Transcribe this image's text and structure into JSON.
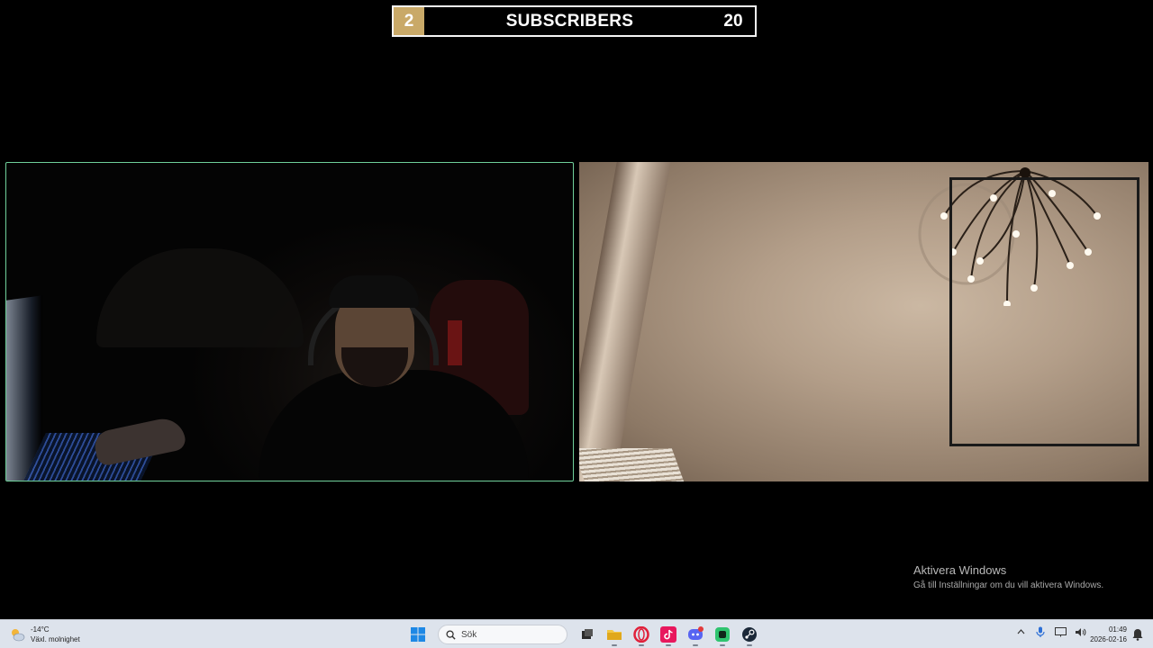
{
  "subscriber_bar": {
    "current": "2",
    "label": "SUBSCRIBERS",
    "goal": "20",
    "accent": "#c9a968"
  },
  "watermark": {
    "title": "Aktivera Windows",
    "subtitle": "Gå till Inställningar om du vill aktivera Windows."
  },
  "taskbar": {
    "weather": {
      "temp": "-14°C",
      "desc": "Växl. molnighet",
      "icon": "partly-cloudy-icon"
    },
    "start_icon": "windows-start-icon",
    "search": {
      "placeholder": "Sök"
    },
    "pinned_apps": [
      {
        "name": "task-view",
        "icon": "task-view-icon"
      },
      {
        "name": "file-explorer",
        "icon": "folder-icon"
      },
      {
        "name": "opera",
        "icon": "opera-icon"
      },
      {
        "name": "tiktok",
        "icon": "tiktok-icon"
      },
      {
        "name": "discord",
        "icon": "discord-icon"
      },
      {
        "name": "app",
        "icon": "green-app-icon"
      },
      {
        "name": "steam",
        "icon": "steam-icon"
      }
    ],
    "tray": {
      "time": "01:49",
      "date": "2026-02-16"
    }
  }
}
